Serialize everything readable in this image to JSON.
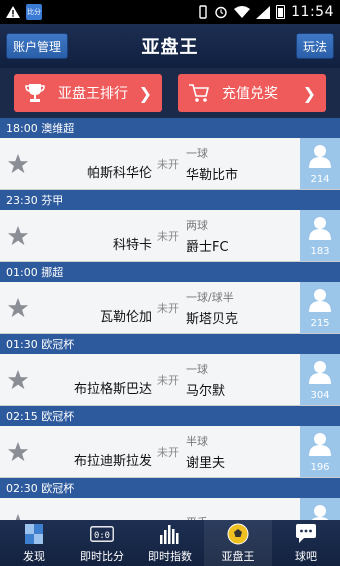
{
  "status_bar": {
    "time": "11:54",
    "app_icon_text": "比分"
  },
  "header": {
    "title": "亚盘王",
    "left_button": "账户管理",
    "right_button": "玩法"
  },
  "actions": [
    {
      "label": "亚盘王排行",
      "icon": "trophy-icon"
    },
    {
      "label": "充值兑奖",
      "icon": "cart-icon"
    }
  ],
  "groups": [
    {
      "time_league": "18:00 澳维超",
      "match": {
        "home": "帕斯科华伦",
        "status": "未开",
        "handicap": "一球",
        "away": "华勒比市",
        "count": "214"
      }
    },
    {
      "time_league": "23:30 芬甲",
      "match": {
        "home": "科特卡",
        "status": "未开",
        "handicap": "两球",
        "away": "爵士FC",
        "count": "183"
      }
    },
    {
      "time_league": "01:00 挪超",
      "match": {
        "home": "瓦勒伦加",
        "status": "未开",
        "handicap": "一球/球半",
        "away": "斯塔贝克",
        "count": "215"
      }
    },
    {
      "time_league": "01:30 欧冠杯",
      "match": {
        "home": "布拉格斯巴达",
        "status": "未开",
        "handicap": "一球",
        "away": "马尔默",
        "count": "304"
      }
    },
    {
      "time_league": "02:15 欧冠杯",
      "match": {
        "home": "布拉迪斯拉发",
        "status": "未开",
        "handicap": "半球",
        "away": "谢里夫",
        "count": "196"
      }
    },
    {
      "time_league": "02:30 欧冠杯",
      "match": {
        "home": "",
        "status": "",
        "handicap": "平手",
        "away": "",
        "count": ""
      }
    }
  ],
  "bottom_nav": [
    {
      "label": "发现",
      "icon": "discover-icon"
    },
    {
      "label": "即时比分",
      "icon": "scoreboard-icon"
    },
    {
      "label": "即时指数",
      "icon": "bar-chart-icon"
    },
    {
      "label": "亚盘王",
      "icon": "football-icon",
      "active": true
    },
    {
      "label": "球吧",
      "icon": "chat-bubble-icon"
    }
  ]
}
